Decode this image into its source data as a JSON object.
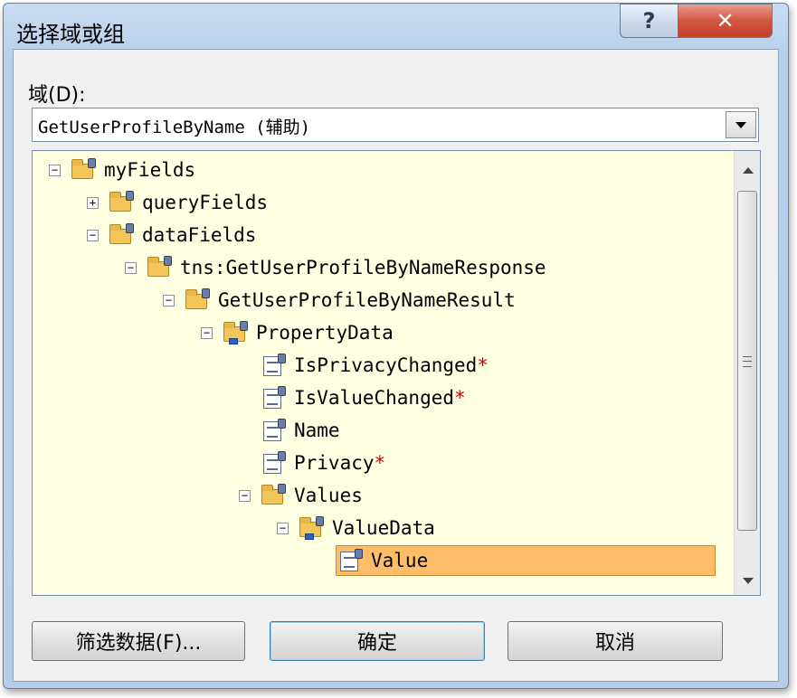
{
  "dialog": {
    "title": "选择域或组",
    "help_glyph": "?",
    "close_glyph": "✕"
  },
  "domain": {
    "label": "域(D):",
    "value": "GetUserProfileByName (辅助)"
  },
  "tree": {
    "nodes": [
      {
        "label": "myFields",
        "expander": "−",
        "type": "folder",
        "required": ""
      },
      {
        "label": "queryFields",
        "expander": "+",
        "type": "folder",
        "required": ""
      },
      {
        "label": "dataFields",
        "expander": "−",
        "type": "folder",
        "required": ""
      },
      {
        "label": "tns:GetUserProfileByNameResponse",
        "expander": "−",
        "type": "folder",
        "required": ""
      },
      {
        "label": "GetUserProfileByNameResult",
        "expander": "−",
        "type": "folder",
        "required": ""
      },
      {
        "label": "PropertyData",
        "expander": "−",
        "type": "repeating-folder",
        "required": ""
      },
      {
        "label": "IsPrivacyChanged",
        "expander": "",
        "type": "field",
        "required": "*"
      },
      {
        "label": "IsValueChanged",
        "expander": "",
        "type": "field",
        "required": "*"
      },
      {
        "label": "Name",
        "expander": "",
        "type": "field",
        "required": ""
      },
      {
        "label": "Privacy",
        "expander": "",
        "type": "field",
        "required": "*"
      },
      {
        "label": "Values",
        "expander": "−",
        "type": "folder",
        "required": ""
      },
      {
        "label": "ValueData",
        "expander": "−",
        "type": "repeating-folder",
        "required": ""
      },
      {
        "label": "Value",
        "expander": "",
        "type": "field",
        "required": "",
        "selected": true
      }
    ]
  },
  "buttons": {
    "filter": "筛选数据(F)...",
    "ok": "确定",
    "cancel": "取消"
  },
  "colors": {
    "tree_background": "#ffffe1",
    "selection": "#ffbd69",
    "required_marker": "#d40000"
  }
}
